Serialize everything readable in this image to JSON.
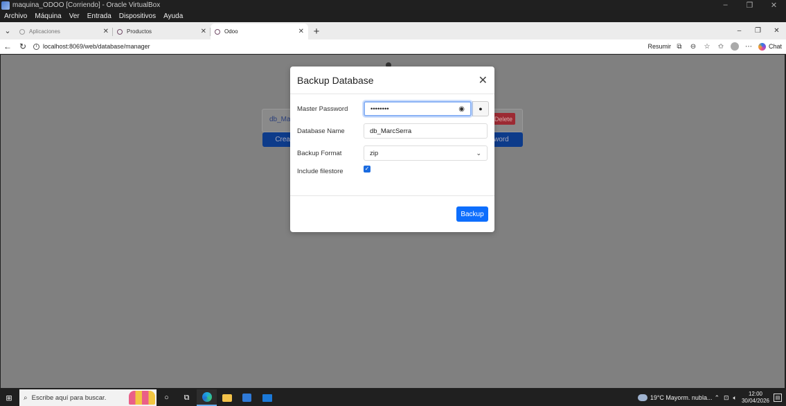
{
  "vbox": {
    "title": "maquina_ODOO [Corriendo] - Oracle VirtualBox",
    "menu": [
      "Archivo",
      "Máquina",
      "Ver",
      "Entrada",
      "Dispositivos",
      "Ayuda"
    ]
  },
  "browser": {
    "tabs": [
      {
        "label": "Aplicaciones"
      },
      {
        "label": "Productos"
      },
      {
        "label": "Odoo"
      }
    ],
    "url": "localhost:8069/web/database/manager",
    "resumir": "Resumir",
    "chat": "Chat"
  },
  "background": {
    "db_link": "db_Mar",
    "delete_label": "Delete",
    "left_btn": "Crea",
    "right_btn": "word"
  },
  "modal": {
    "title": "Backup Database",
    "master_password_label": "Master Password",
    "master_password_value": "••••••••",
    "database_name_label": "Database Name",
    "database_name_value": "db_MarcSerra",
    "backup_format_label": "Backup Format",
    "backup_format_value": "zip",
    "include_filestore_label": "Include filestore",
    "include_filestore_checked": true,
    "backup_button": "Backup"
  },
  "taskbar": {
    "search_placeholder": "Escribe aquí para buscar.",
    "weather": "19°C  Mayorm. nubla...",
    "time": "12:00",
    "date": "30/04/2026"
  }
}
